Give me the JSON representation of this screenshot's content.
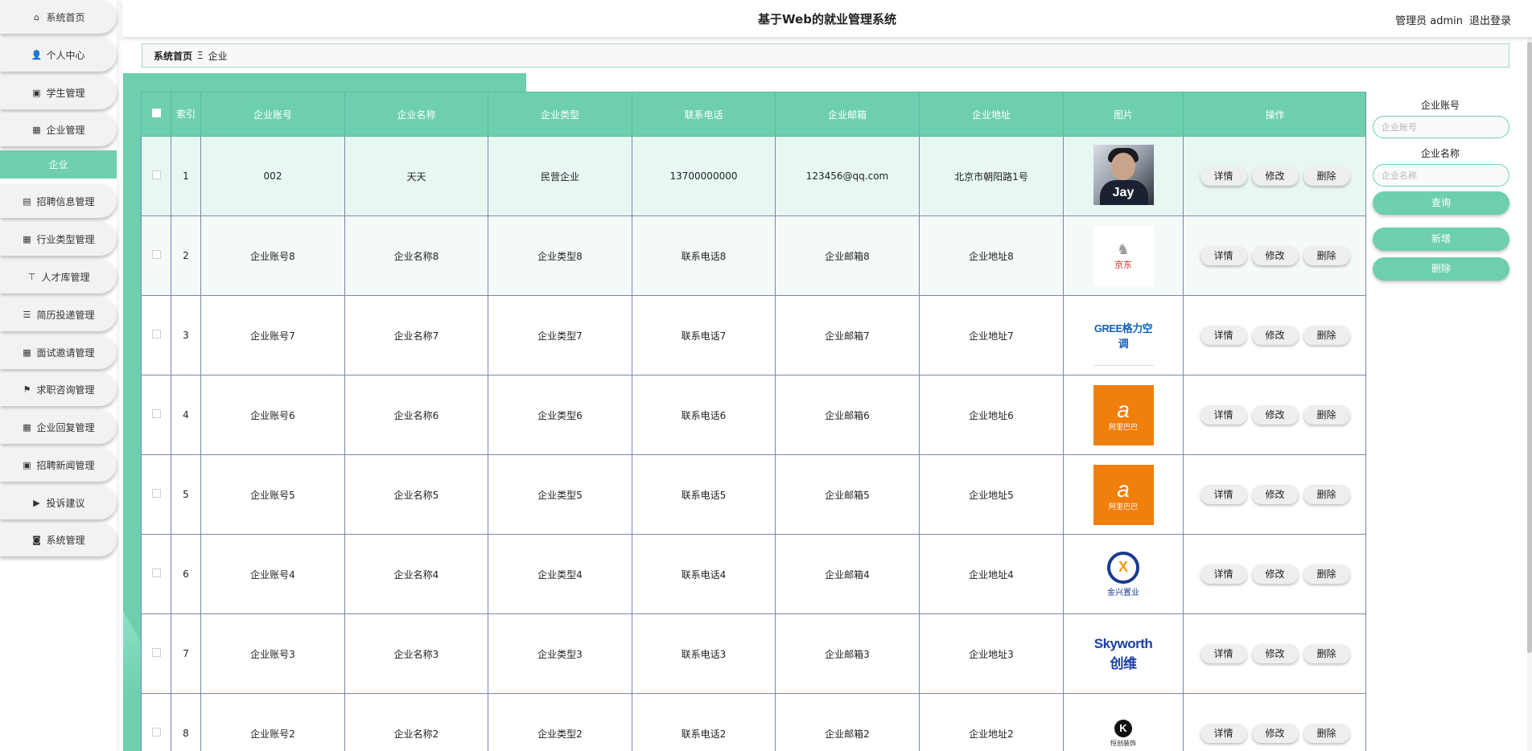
{
  "sidebar": {
    "items": [
      {
        "label": "系统首页",
        "icon": "home-icon",
        "glyph": "⌂"
      },
      {
        "label": "个人中心",
        "icon": "user-icon",
        "glyph": "👤"
      },
      {
        "label": "学生管理",
        "icon": "clipboard-icon",
        "glyph": "▣"
      },
      {
        "label": "企业管理",
        "icon": "grid-icon",
        "glyph": "▦"
      },
      {
        "label": "企业",
        "icon": "",
        "glyph": ""
      },
      {
        "label": "招聘信息管理",
        "icon": "chart-icon",
        "glyph": "▤"
      },
      {
        "label": "行业类型管理",
        "icon": "grid-icon",
        "glyph": "▦"
      },
      {
        "label": "人才库管理",
        "icon": "pin-icon",
        "glyph": "⊤"
      },
      {
        "label": "简历投递管理",
        "icon": "list-icon",
        "glyph": "☰"
      },
      {
        "label": "面试邀请管理",
        "icon": "grid-icon",
        "glyph": "▦"
      },
      {
        "label": "求职咨询管理",
        "icon": "flag-icon",
        "glyph": "⚑"
      },
      {
        "label": "企业回复管理",
        "icon": "grid-icon",
        "glyph": "▦"
      },
      {
        "label": "招聘新闻管理",
        "icon": "clipboard-icon",
        "glyph": "▣"
      },
      {
        "label": "投诉建议",
        "icon": "video-icon",
        "glyph": "▶"
      },
      {
        "label": "系统管理",
        "icon": "database-icon",
        "glyph": "◙"
      }
    ]
  },
  "header": {
    "title": "基于Web的就业管理系统",
    "user_label": "管理员 admin",
    "logout_label": "退出登录"
  },
  "breadcrumb": {
    "home": "系统首页",
    "separator": "Ξ",
    "current": "企业"
  },
  "table": {
    "columns": [
      "索引",
      "企业账号",
      "企业名称",
      "企业类型",
      "联系电话",
      "企业邮箱",
      "企业地址",
      "图片",
      "操作"
    ],
    "rows": [
      {
        "index": "1",
        "account": "002",
        "name": "天天",
        "type": "民营企业",
        "phone": "13700000000",
        "email": "123456@qq.com",
        "address": "北京市朝阳路1号",
        "image": "photo-jay",
        "image_text": "Jay"
      },
      {
        "index": "2",
        "account": "企业账号8",
        "name": "企业名称8",
        "type": "企业类型8",
        "phone": "联系电话8",
        "email": "企业邮箱8",
        "address": "企业地址8",
        "image": "logo-jd",
        "image_text": "京东"
      },
      {
        "index": "3",
        "account": "企业账号7",
        "name": "企业名称7",
        "type": "企业类型7",
        "phone": "联系电话7",
        "email": "企业邮箱7",
        "address": "企业地址7",
        "image": "logo-gree",
        "image_text": "GREE格力空调"
      },
      {
        "index": "4",
        "account": "企业账号6",
        "name": "企业名称6",
        "type": "企业类型6",
        "phone": "联系电话6",
        "email": "企业邮箱6",
        "address": "企业地址6",
        "image": "logo-alibaba",
        "image_text": "阿里巴巴"
      },
      {
        "index": "5",
        "account": "企业账号5",
        "name": "企业名称5",
        "type": "企业类型5",
        "phone": "联系电话5",
        "email": "企业邮箱5",
        "address": "企业地址5",
        "image": "logo-alibaba",
        "image_text": "阿里巴巴"
      },
      {
        "index": "6",
        "account": "企业账号4",
        "name": "企业名称4",
        "type": "企业类型4",
        "phone": "联系电话4",
        "email": "企业邮箱4",
        "address": "企业地址4",
        "image": "logo-jinxing",
        "image_text": "金兴置业"
      },
      {
        "index": "7",
        "account": "企业账号3",
        "name": "企业名称3",
        "type": "企业类型3",
        "phone": "联系电话3",
        "email": "企业邮箱3",
        "address": "企业地址3",
        "image": "logo-skyworth",
        "image_text": "Skyworth 创维"
      },
      {
        "index": "8",
        "account": "企业账号2",
        "name": "企业名称2",
        "type": "企业类型2",
        "phone": "联系电话2",
        "email": "企业邮箱2",
        "address": "企业地址2",
        "image": "logo-k",
        "image_text": "恒创装饰"
      }
    ],
    "actions": {
      "detail": "详情",
      "edit": "修改",
      "delete": "删除"
    }
  },
  "search": {
    "account_label": "企业账号",
    "account_placeholder": "企业账号",
    "name_label": "企业名称",
    "name_placeholder": "企业名称",
    "search_button": "查询",
    "add_button": "新增",
    "delete_button": "删除"
  },
  "colors": {
    "accent": "#6dcfb0",
    "row_selected": "#e8f7f1",
    "border": "#7a86b3"
  }
}
